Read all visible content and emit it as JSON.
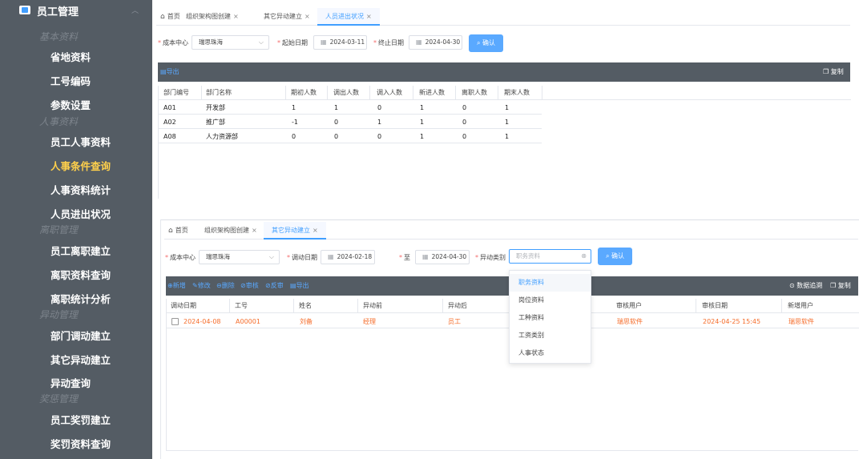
{
  "sidebar": {
    "title": "员工管理",
    "groups": [
      {
        "label": "基本资料"
      },
      {
        "label": "人事资料"
      },
      {
        "label": "离职管理"
      },
      {
        "label": "异动管理"
      },
      {
        "label": "奖惩管理"
      }
    ],
    "items": [
      {
        "label": "省地资料"
      },
      {
        "label": "工号编码"
      },
      {
        "label": "参数设置"
      },
      {
        "label": "员工人事资料"
      },
      {
        "label": "人事条件查询"
      },
      {
        "label": "人事资料统计"
      },
      {
        "label": "人员进出状况"
      },
      {
        "label": "员工离职建立"
      },
      {
        "label": "离职资料查询"
      },
      {
        "label": "离职统计分析"
      },
      {
        "label": "部门调动建立"
      },
      {
        "label": "其它异动建立"
      },
      {
        "label": "异动查询"
      },
      {
        "label": "员工奖罚建立"
      },
      {
        "label": "奖罚资料查询"
      }
    ],
    "active_color": "#ffd04b",
    "bg_color": "#545c64"
  },
  "panel1": {
    "tabs": [
      {
        "label": "首页"
      },
      {
        "label": "组织架构图创建"
      },
      {
        "label": "其它异动建立"
      },
      {
        "label": "人员进出状况"
      }
    ],
    "filters": {
      "cost_center_label": "成本中心",
      "cost_center_value": "瑞思珠海",
      "start_label": "起始日期",
      "start_value": "2024-03-11",
      "end_label": "终止日期",
      "end_value": "2024-04-30",
      "confirm_label": "确认"
    },
    "toolbar": {
      "export_label": "导出",
      "copy_label": "复制"
    },
    "columns": [
      "部门编号",
      "部门名称",
      "期初人数",
      "调出人数",
      "调入人数",
      "新进人数",
      "离职人数",
      "期末人数"
    ],
    "rows": [
      [
        "A01",
        "开发部",
        "1",
        "1",
        "0",
        "1",
        "0",
        "1"
      ],
      [
        "A02",
        "推广部",
        "-1",
        "0",
        "1",
        "1",
        "0",
        "1"
      ],
      [
        "A08",
        "人力资源部",
        "0",
        "0",
        "0",
        "1",
        "0",
        "1"
      ]
    ]
  },
  "panel2": {
    "tabs": [
      {
        "label": "首页"
      },
      {
        "label": "组织架构图创建"
      },
      {
        "label": "其它异动建立"
      }
    ],
    "filters": {
      "cost_center_label": "成本中心",
      "cost_center_value": "瑞思珠海",
      "move_date_label": "调动日期",
      "move_date_from": "2024-02-18",
      "to_label": "至",
      "move_date_to": "2024-04-30",
      "category_label": "异动类别",
      "category_placeholder": "职务资料",
      "confirm_label": "确认"
    },
    "toolbar": {
      "add_label": "新增",
      "edit_label": "修改",
      "delete_label": "删除",
      "approve_label": "审核",
      "unapprove_label": "反审",
      "export_label": "导出",
      "trace_label": "数据追溯",
      "copy_label": "复制"
    },
    "columns": [
      "调动日期",
      "工号",
      "姓名",
      "异动前",
      "异动后",
      "审核用户",
      "审核日期",
      "新增用户"
    ],
    "rows": [
      [
        "2024-04-08",
        "A00001",
        "刘备",
        "经理",
        "员工",
        "瑞思软件",
        "2024-04-25 15:45",
        "瑞思软件"
      ]
    ],
    "dropdown": {
      "options": [
        {
          "label": "职务资料"
        },
        {
          "label": "岗位资料"
        },
        {
          "label": "工种资料"
        },
        {
          "label": "工资类别"
        },
        {
          "label": "人事状态"
        }
      ]
    },
    "highlight_color": "#f56c2a"
  }
}
